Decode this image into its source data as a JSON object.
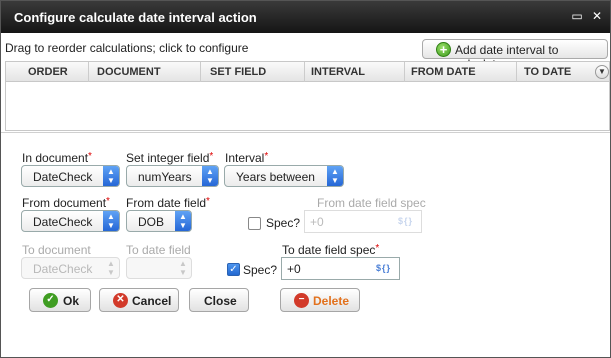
{
  "window": {
    "title": "Configure calculate date interval action",
    "maximize_glyph": "▭",
    "close_glyph": "✕"
  },
  "toolbar": {
    "hint": "Drag to reorder calculations; click to configure",
    "add_button_label": "Add date interval to calculate",
    "add_icon": "plus-circle-icon"
  },
  "grid": {
    "columns": [
      "ORDER",
      "DOCUMENT",
      "SET FIELD",
      "INTERVAL",
      "FROM DATE",
      "TO DATE"
    ],
    "menu_glyph": "▼"
  },
  "form": {
    "in_document": {
      "label": "In document",
      "required": "*",
      "value": "DateCheck"
    },
    "set_integer_field": {
      "label": "Set integer field",
      "required": "*",
      "value": "numYears"
    },
    "interval": {
      "label": "Interval",
      "required": "*",
      "value": "Years between"
    },
    "from_document": {
      "label": "From document",
      "required": "*",
      "value": "DateCheck"
    },
    "from_date_field": {
      "label": "From date field",
      "required": "*",
      "value": "DOB"
    },
    "from_spec": {
      "checkbox_label": "Spec?",
      "checked": false,
      "field_label": "From date field spec",
      "placeholder": "+0",
      "fx": "${}"
    },
    "to_document": {
      "label": "To document",
      "value": "DateCheck"
    },
    "to_date_field": {
      "label": "To date field",
      "value": ""
    },
    "to_spec": {
      "checkbox_label": "Spec?",
      "checked": true,
      "field_label": "To date field spec",
      "required": "*",
      "value": "+0",
      "fx": "${}"
    }
  },
  "buttons": {
    "ok": "Ok",
    "cancel": "Cancel",
    "close": "Close",
    "delete": "Delete"
  },
  "colors": {
    "title_bar": "#1f1f1f",
    "accent_blue": "#2566d6",
    "ok_green": "#3f9d22",
    "cancel_red": "#d23a2a",
    "delete_orange": "#e2711d"
  }
}
